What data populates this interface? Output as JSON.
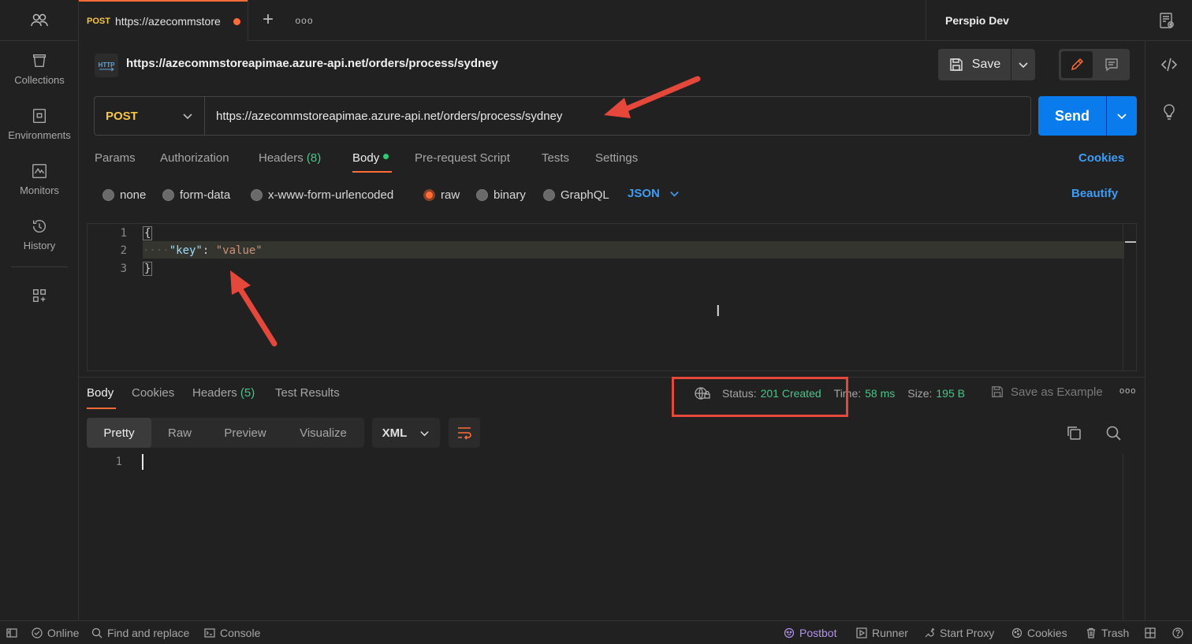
{
  "nav": {
    "collections": "Collections",
    "environments": "Environments",
    "monitors": "Monitors",
    "history": "History"
  },
  "tab": {
    "method": "POST",
    "url": "https://azecommstore"
  },
  "environment": "Perspio Dev",
  "request": {
    "title": "https://azecommstoreapimae.azure-api.net/orders/process/sydney",
    "method": "POST",
    "url": "https://azecommstoreapimae.azure-api.net/orders/process/sydney",
    "save_label": "Save",
    "send_label": "Send"
  },
  "req_tabs": {
    "params": "Params",
    "authorization": "Authorization",
    "headers": "Headers",
    "headers_count": "(8)",
    "body": "Body",
    "pre_request": "Pre-request Script",
    "tests": "Tests",
    "settings": "Settings",
    "cookies": "Cookies"
  },
  "body_types": {
    "none": "none",
    "form_data": "form-data",
    "urlencoded": "x-www-form-urlencoded",
    "raw": "raw",
    "binary": "binary",
    "graphql": "GraphQL",
    "selected": "raw",
    "language": "JSON",
    "beautify": "Beautify"
  },
  "editor": {
    "line_numbers": [
      "1",
      "2",
      "3"
    ],
    "open_brace": "{",
    "key": "\"key\"",
    "colon": ": ",
    "value": "\"value\"",
    "close_brace": "}"
  },
  "response": {
    "tabs": {
      "body": "Body",
      "cookies": "Cookies",
      "headers": "Headers",
      "headers_count": "(5)",
      "test_results": "Test Results"
    },
    "status_label": "Status:",
    "status_value": "201 Created",
    "time_label": "Time:",
    "time_value": "58 ms",
    "size_label": "Size:",
    "size_value": "195 B",
    "save_example": "Save as Example",
    "formats": [
      "Pretty",
      "Raw",
      "Preview",
      "Visualize"
    ],
    "selected_format": "Pretty",
    "language": "XML",
    "line_number": "1"
  },
  "footer": {
    "online": "Online",
    "find_replace": "Find and replace",
    "console": "Console",
    "postbot": "Postbot",
    "runner": "Runner",
    "start_proxy": "Start Proxy",
    "cookies": "Cookies",
    "trash": "Trash"
  },
  "colors": {
    "accent_orange": "#ff6c37",
    "send_blue": "#097bed",
    "method_yellow": "#f6c744",
    "success_green": "#4cc38a",
    "annotation_red": "#e5473b"
  }
}
